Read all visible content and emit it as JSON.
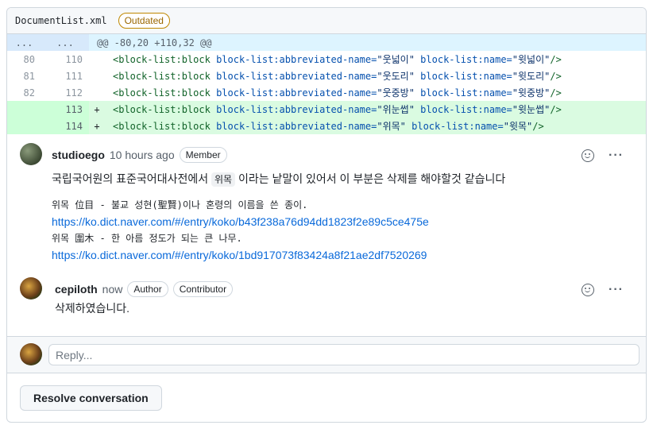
{
  "file": {
    "name": "DocumentList.xml",
    "status_badge": "Outdated"
  },
  "diff": {
    "hunk": {
      "left": "...",
      "right": "...",
      "text": "@@ -80,20 +110,32 @@"
    },
    "lines": [
      {
        "old": "80",
        "new": "110",
        "sign": "",
        "added": false,
        "tag": "<block-list:block",
        "attr1": "block-list:abbreviated-name=",
        "val1": "\"웃넓이\"",
        "attr2": "block-list:name=",
        "val2": "\"윗넓이\"",
        "end": "/>"
      },
      {
        "old": "81",
        "new": "111",
        "sign": "",
        "added": false,
        "tag": "<block-list:block",
        "attr1": "block-list:abbreviated-name=",
        "val1": "\"웃도리\"",
        "attr2": "block-list:name=",
        "val2": "\"윗도리\"",
        "end": "/>"
      },
      {
        "old": "82",
        "new": "112",
        "sign": "",
        "added": false,
        "tag": "<block-list:block",
        "attr1": "block-list:abbreviated-name=",
        "val1": "\"웃중방\"",
        "attr2": "block-list:name=",
        "val2": "\"윗중방\"",
        "end": "/>"
      },
      {
        "old": "",
        "new": "113",
        "sign": "+",
        "added": true,
        "tag": "<block-list:block",
        "attr1": "block-list:abbreviated-name=",
        "val1": "\"위눈썹\"",
        "attr2": "block-list:name=",
        "val2": "\"윗눈썹\"",
        "end": "/>"
      },
      {
        "old": "",
        "new": "114",
        "sign": "+",
        "added": true,
        "tag": "<block-list:block",
        "attr1": "block-list:abbreviated-name=",
        "val1": "\"위목\"",
        "attr2": "block-list:name=",
        "val2": "\"윗목\"",
        "end": "/>"
      }
    ]
  },
  "comments": [
    {
      "author": "studioego",
      "time": "10 hours ago",
      "badges": [
        "Member"
      ],
      "text_before": "국립국어원의 표준국어대사전에서",
      "code": "위목",
      "text_after": "이라는 낱말이 있어서 이 부분은 삭제를 해야할것 같습니다",
      "def1": "위목 位目 - 불교 성현(聖賢)이나 혼령의 이름을 쓴 종이.",
      "link1": "https://ko.dict.naver.com/#/entry/koko/b43f238a76d94dd1823f2e89c5ce475e",
      "def2": "위목 圍木 - 한 아름 정도가 되는 큰 나무.",
      "link2": "https://ko.dict.naver.com/#/entry/koko/1bd917073f83424a8f21ae2df7520269"
    },
    {
      "author": "cepiloth",
      "time": "now",
      "badges": [
        "Author",
        "Contributor"
      ],
      "text": "삭제하였습니다."
    }
  ],
  "reply": {
    "placeholder": "Reply..."
  },
  "resolve_label": "Resolve conversation",
  "icons": {
    "reaction": "smiley-icon",
    "menu": "kebab-horizontal-icon"
  }
}
